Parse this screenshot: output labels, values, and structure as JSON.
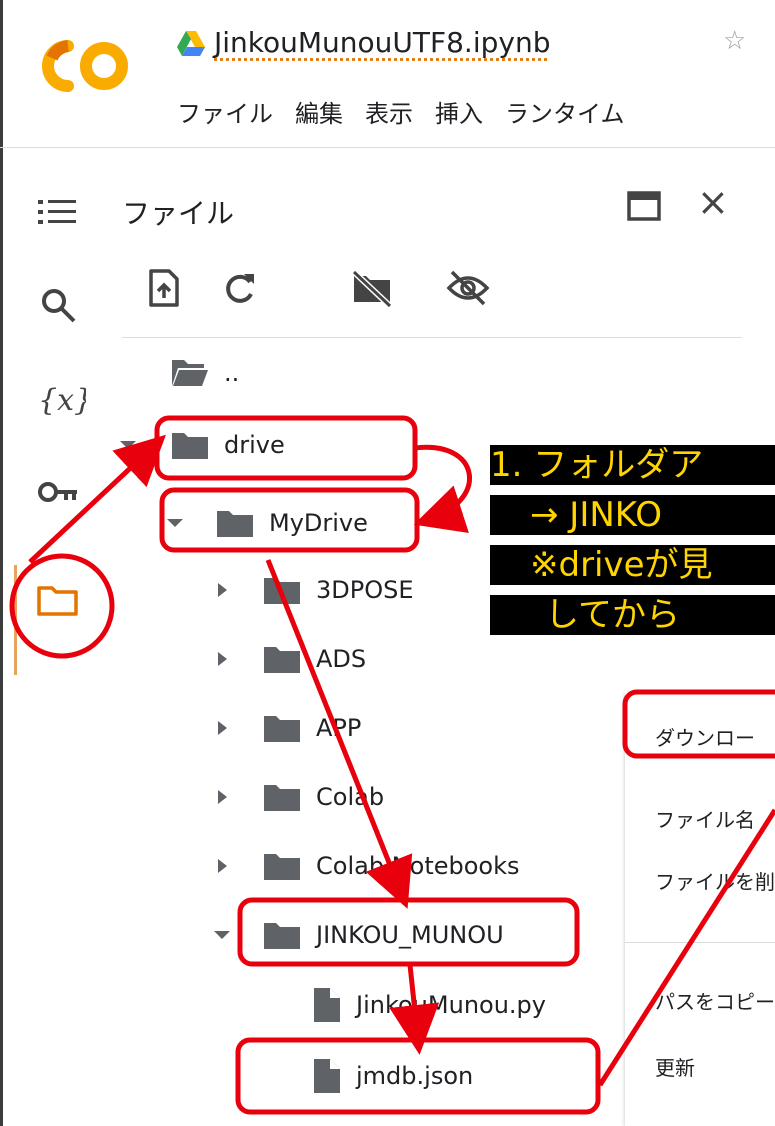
{
  "header": {
    "doc_title": "JinkouMunouUTF8.ipynb",
    "star_glyph": "☆",
    "menu": [
      "ファイル",
      "編集",
      "表示",
      "挿入",
      "ランタイム"
    ]
  },
  "panel": {
    "title": "ファイル",
    "close_glyph": "×"
  },
  "tree": {
    "parent": "..",
    "drive": "drive",
    "mydrive": "MyDrive",
    "folders": [
      "3DPOSE",
      "ADS",
      "APP",
      "Colab",
      "Colab Notebooks"
    ],
    "target_folder": "JINKOU_MUNOU",
    "files": [
      "JinkouMunou.py",
      "jmdb.json"
    ]
  },
  "context_menu": {
    "items": [
      "ダウンロー",
      "ファイル名",
      "ファイルを削",
      "パスをコピー",
      "更新"
    ]
  },
  "annotation": {
    "lines": [
      "1. フォルダア",
      "→ JINKO",
      "※driveが見",
      "してから"
    ]
  },
  "colors": {
    "annotation_red": "#e8000d",
    "annotation_text": "#ffd400",
    "folder_gray": "#5f6368",
    "active_rail": "#e8a35c"
  },
  "icons": [
    "colab-logo",
    "drive-icon",
    "star-icon",
    "toc-icon",
    "search-icon",
    "variables-icon",
    "key-icon",
    "folder-icon",
    "window-icon",
    "close-icon",
    "upload-file-icon",
    "refresh-icon",
    "drive-off-icon",
    "hidden-eye-icon"
  ]
}
